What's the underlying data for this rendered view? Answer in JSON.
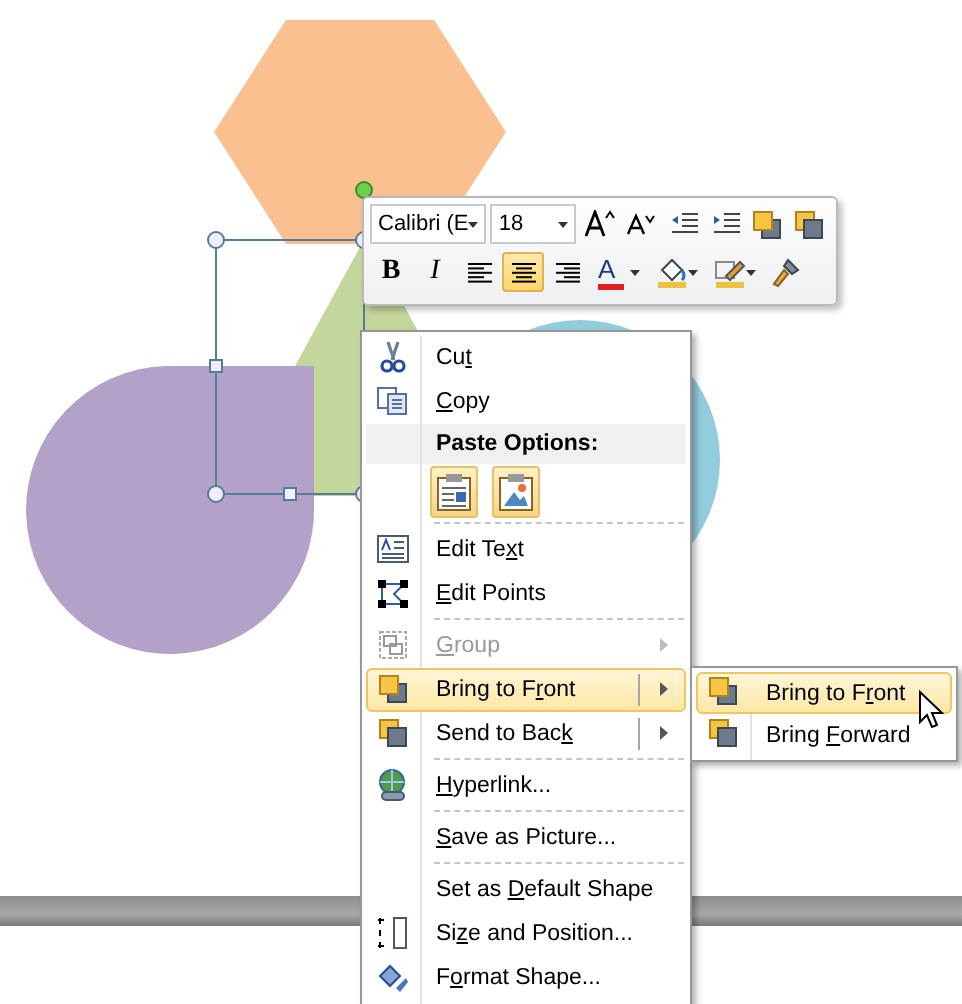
{
  "mini_toolbar": {
    "font_field": {
      "value": "Calibri (E"
    },
    "size_field": {
      "value": "18"
    },
    "row_1": [
      {
        "kind": "grow"
      },
      {
        "kind": "shrink"
      },
      {
        "kind": "outdent"
      },
      {
        "kind": "indent"
      },
      {
        "kind": "front"
      },
      {
        "kind": "back"
      }
    ],
    "row_2": [
      {
        "kind": "bold",
        "label": "B",
        "selected": false
      },
      {
        "kind": "italic",
        "label": "I",
        "selected": false
      },
      {
        "kind": "left",
        "selected": false
      },
      {
        "kind": "center",
        "selected": true
      },
      {
        "kind": "right",
        "selected": false
      },
      {
        "kind": "fontcolor",
        "label": "A",
        "color": "#e02020"
      },
      {
        "kind": "fill"
      },
      {
        "kind": "outline"
      },
      {
        "kind": "painter"
      }
    ]
  },
  "context_menu": [
    {
      "kind": "item",
      "label": {
        "before": "Cu",
        "key": "t"
      },
      "disabled": false,
      "highlighted": false,
      "has_submenu": false,
      "separator_before": false
    },
    {
      "kind": "item",
      "label": {
        "key": "C",
        "after": "opy"
      },
      "disabled": false,
      "highlighted": false,
      "has_submenu": false,
      "separator_before": false
    },
    {
      "kind": "header",
      "text": "Paste Options:"
    },
    {
      "kind": "paste_options"
    },
    {
      "kind": "item",
      "label": {
        "before": "Edit Te",
        "key": "x",
        "after": "t"
      },
      "disabled": false,
      "highlighted": false,
      "has_submenu": false,
      "separator_before": true
    },
    {
      "kind": "item",
      "label": {
        "key": "E",
        "after": "dit Points"
      },
      "disabled": false,
      "highlighted": false,
      "has_submenu": false,
      "separator_before": false
    },
    {
      "kind": "item",
      "label": {
        "key": "G",
        "after": "roup"
      },
      "disabled": true,
      "highlighted": false,
      "has_submenu": true,
      "separator_before": true
    },
    {
      "kind": "item",
      "label": {
        "before": "Bring to F",
        "key": "r",
        "after": "ont"
      },
      "disabled": false,
      "highlighted": true,
      "has_submenu": true,
      "separator_before": false
    },
    {
      "kind": "item",
      "label": {
        "before": "Send to Bac",
        "key": "k"
      },
      "disabled": false,
      "highlighted": false,
      "has_submenu": true,
      "separator_before": false
    },
    {
      "kind": "item",
      "label": {
        "key": "H",
        "after": "yperlink..."
      },
      "disabled": false,
      "highlighted": false,
      "has_submenu": false,
      "separator_before": true
    },
    {
      "kind": "item",
      "label": {
        "key": "S",
        "after": "ave as Picture..."
      },
      "disabled": false,
      "highlighted": false,
      "has_submenu": false,
      "separator_before": true
    },
    {
      "kind": "item",
      "label": {
        "before": "Set as ",
        "key": "D",
        "after": "efault Shape"
      },
      "disabled": false,
      "highlighted": false,
      "has_submenu": false,
      "separator_before": true
    },
    {
      "kind": "item",
      "label": {
        "before": "Si",
        "key": "z",
        "after": "e and Position..."
      },
      "disabled": false,
      "highlighted": false,
      "has_submenu": false,
      "separator_before": false
    },
    {
      "kind": "item",
      "label": {
        "before": "F",
        "key": "o",
        "after": "rmat Shape..."
      },
      "disabled": false,
      "highlighted": false,
      "has_submenu": false,
      "separator_before": false
    }
  ],
  "submenu": [
    {
      "label": {
        "before": "Bring to F",
        "key": "r",
        "after": "ont"
      },
      "highlighted": true
    },
    {
      "label": {
        "before": "Bring ",
        "key": "F",
        "after": "orward"
      },
      "highlighted": false
    }
  ]
}
